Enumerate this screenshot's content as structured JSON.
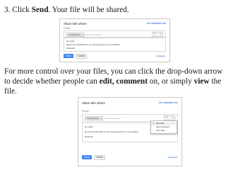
{
  "step3": {
    "pre": "3. Click ",
    "bold": "Send",
    "post": ". Your file will be shared."
  },
  "more_control": {
    "t1": "For more control over your files, you can click the drop-down arrow to decide whether people can ",
    "edit": "edit,",
    "t2": " ",
    "comment": "comment",
    "t3": " on, or simply ",
    "view": "view",
    "t4": " the file."
  },
  "share_dialog_1": {
    "title": "Share with others",
    "shareable_link": "Get shareable link",
    "people_label": "People",
    "chip": "Linda Petrov",
    "chip_close": "×",
    "add_more": "Add more people...",
    "message_lines": [
      "Hi Linda,",
      "Here's the schedule for our upcoming trip! I'm so excited!",
      "Deborah"
    ],
    "send": "Send",
    "cancel": "Cancel",
    "advanced": "Advanced"
  },
  "share_dialog_2": {
    "title": "Share with others",
    "shareable_link": "Get shareable link",
    "people_label": "People",
    "chip": "Linda Petrov",
    "chip_close": "×",
    "add_more": "Add more people...",
    "message_lines": [
      "Hi Linda,",
      "Here's the schedule for our upcoming trip! I'm so excited!",
      "Deborah"
    ],
    "send": "Send",
    "cancel": "Cancel",
    "advanced": "Advanced",
    "permission_options": [
      "Can edit",
      "Can comment",
      "Can view"
    ],
    "selected_option": "Can edit"
  },
  "icons": {
    "permission": "pencil-icon",
    "caret": "chevron-down-icon",
    "check": "checkmark-icon"
  },
  "colors": {
    "send_button": "#4285f4",
    "link": "#1155cc"
  }
}
